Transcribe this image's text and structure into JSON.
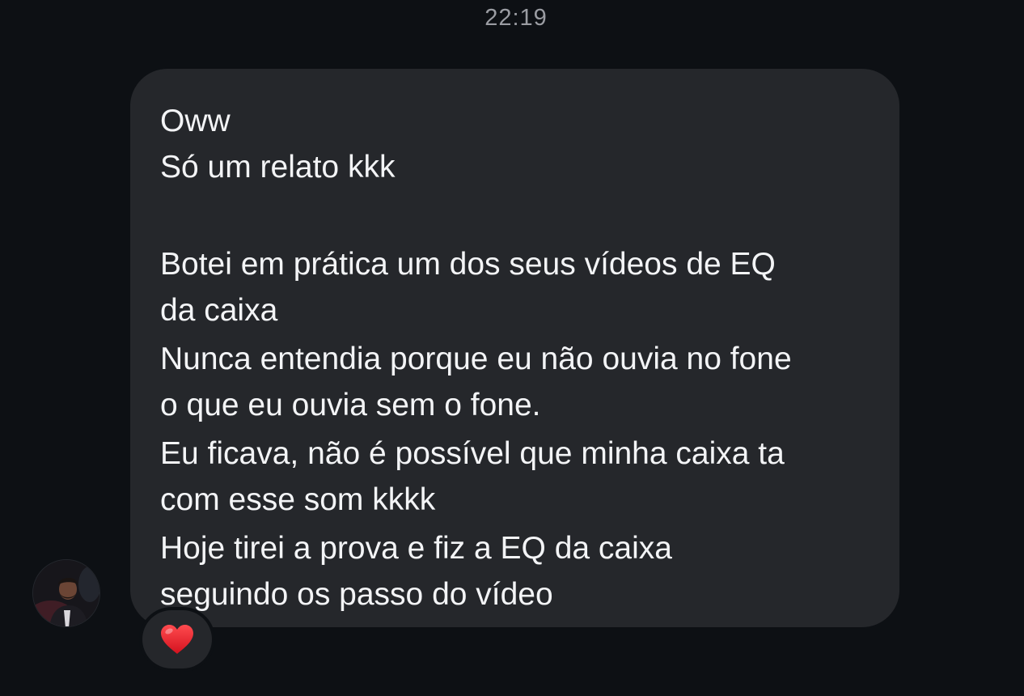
{
  "conversation": {
    "timestamp": "22:19"
  },
  "message": {
    "sender_avatar_icon": "user-avatar-icon",
    "lines": [
      "Oww",
      "Só um relato kkk",
      "",
      "Botei em prática um dos seus vídeos de EQ",
      "da caixa",
      "Nunca entendia porque eu não ouvia no fone",
      "o que eu ouvia sem o fone.",
      "Eu ficava, não é possível que minha caixa ta",
      "com esse som kkkk",
      "Hoje tirei a prova e fiz a EQ da caixa",
      "seguindo os passo do vídeo"
    ],
    "reaction": {
      "emoji": "❤️",
      "icon": "heart-icon"
    }
  },
  "colors": {
    "background": "#0d1014",
    "bubble": "#25272b",
    "text": "#f3f4f6",
    "timestamp": "#9a9ca2",
    "heart": "#e0212c"
  }
}
